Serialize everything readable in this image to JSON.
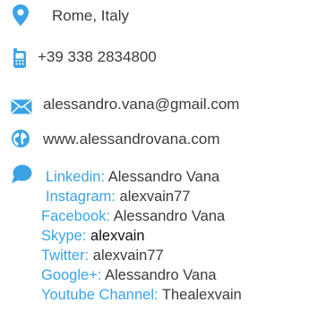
{
  "contact": {
    "location": "Rome, Italy",
    "phone": "+39 338 2834800",
    "email": "alessandro.vana@gmail.com",
    "website": "www.alessandrovana.com"
  },
  "social": [
    {
      "label": "Linkedin:",
      "value": "Alessandro Vana"
    },
    {
      "label": "Instagram:",
      "value": "alexvain77"
    },
    {
      "label": "Facebook:",
      "value": "Alessandro Vana"
    },
    {
      "label": "Skype:",
      "value": "alexvain"
    },
    {
      "label": "Twitter:",
      "value": "alexvain77"
    },
    {
      "label": "Google+:",
      "value": "Alessandro Vana"
    },
    {
      "label": "Youtube Channel:",
      "value": "Thealexvain"
    }
  ],
  "colors": {
    "accent": "#3aa3e6",
    "text": "#3b3b3b"
  },
  "icons": [
    "location-pin-icon",
    "mobile-phone-icon",
    "envelope-icon",
    "globe-icon",
    "speech-bubble-icon"
  ]
}
